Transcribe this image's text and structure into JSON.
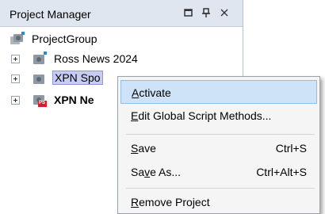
{
  "panel": {
    "title": "Project Manager",
    "buttons": {
      "float_icon": "restore-icon",
      "pin_icon": "pin-icon",
      "close_icon": "close-icon"
    },
    "tree": [
      {
        "label": "ProjectGroup",
        "icon": "project-group-icon",
        "bold": false,
        "expandable": false
      },
      {
        "label": "Ross News 2024",
        "icon": "project-icon",
        "bold": false,
        "expandable": true
      },
      {
        "label": "XPN Sports",
        "visible_label": "XPN Spo",
        "icon": "project-icon",
        "bold": false,
        "expandable": true,
        "selected": true
      },
      {
        "label": "XPN Ne",
        "icon": "project-ps-icon",
        "badge": "PS",
        "bold": true,
        "expandable": true
      }
    ]
  },
  "context_menu": {
    "items": [
      {
        "label": "Activate",
        "mnemonic": "A",
        "shortcut": "",
        "highlighted": true
      },
      {
        "label": "Edit Global Script Methods...",
        "mnemonic": "E",
        "shortcut": ""
      },
      {
        "label": "Save",
        "mnemonic": "S",
        "shortcut": "Ctrl+S"
      },
      {
        "label": "Save As...",
        "mnemonic": "v",
        "shortcut": "Ctrl+Alt+S"
      },
      {
        "label": "Remove Project",
        "mnemonic": "R",
        "shortcut": ""
      }
    ]
  },
  "colors": {
    "titlebar_bg": "#dfe6ef",
    "selection_bg": "#c7ccf2",
    "menu_highlight": "#cfe3f8",
    "menu_bg": "#f5f5f5",
    "badge_red": "#d0202a"
  }
}
